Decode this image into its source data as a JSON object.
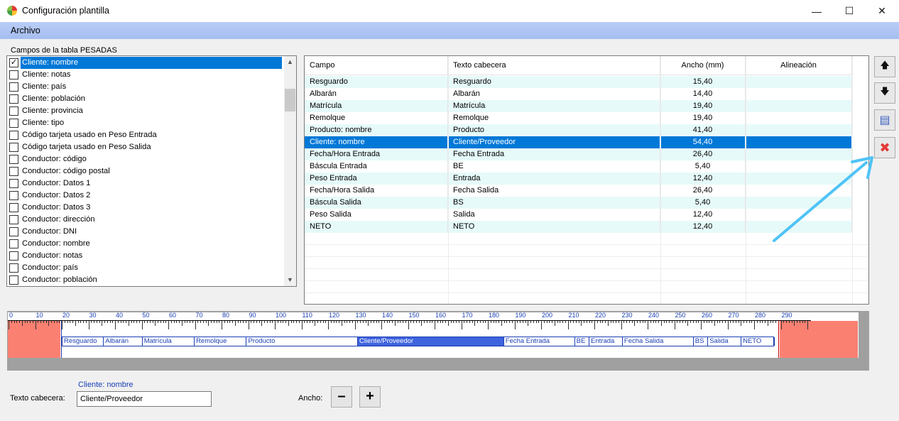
{
  "window": {
    "title": "Configuración plantilla",
    "controls": [
      "—",
      "☐",
      "✕"
    ]
  },
  "menu": {
    "items": [
      "Archivo"
    ]
  },
  "fields_panel": {
    "label": "Campos de la tabla PESADAS",
    "items": [
      {
        "label": "Cliente: nombre",
        "checked": true,
        "selected": true
      },
      {
        "label": "Cliente: notas",
        "checked": false
      },
      {
        "label": "Cliente: país",
        "checked": false
      },
      {
        "label": "Cliente: población",
        "checked": false
      },
      {
        "label": "Cliente: provincia",
        "checked": false
      },
      {
        "label": "Cliente: tipo",
        "checked": false
      },
      {
        "label": "Código tarjeta usado en Peso Entrada",
        "checked": false
      },
      {
        "label": "Código tarjeta usado en Peso Salida",
        "checked": false
      },
      {
        "label": "Conductor: código",
        "checked": false
      },
      {
        "label": "Conductor: código postal",
        "checked": false
      },
      {
        "label": "Conductor: Datos 1",
        "checked": false
      },
      {
        "label": "Conductor: Datos 2",
        "checked": false
      },
      {
        "label": "Conductor: Datos 3",
        "checked": false
      },
      {
        "label": "Conductor: dirección",
        "checked": false
      },
      {
        "label": "Conductor: DNI",
        "checked": false
      },
      {
        "label": "Conductor: nombre",
        "checked": false
      },
      {
        "label": "Conductor: notas",
        "checked": false
      },
      {
        "label": "Conductor: país",
        "checked": false
      },
      {
        "label": "Conductor: población",
        "checked": false
      }
    ]
  },
  "columns_grid": {
    "headers": [
      "Campo",
      "Texto cabecera",
      "Ancho (mm)",
      "Alineación"
    ],
    "rows": [
      {
        "campo": "Resguardo",
        "texto": "Resguardo",
        "ancho": "15,40",
        "alineacion": ""
      },
      {
        "campo": "Albarán",
        "texto": "Albarán",
        "ancho": "14,40",
        "alineacion": ""
      },
      {
        "campo": "Matrícula",
        "texto": "Matrícula",
        "ancho": "19,40",
        "alineacion": ""
      },
      {
        "campo": "Remolque",
        "texto": "Remolque",
        "ancho": "19,40",
        "alineacion": ""
      },
      {
        "campo": "Producto: nombre",
        "texto": "Producto",
        "ancho": "41,40",
        "alineacion": ""
      },
      {
        "campo": "Cliente: nombre",
        "texto": "Cliente/Proveedor",
        "ancho": "54,40",
        "alineacion": "",
        "selected": true
      },
      {
        "campo": "Fecha/Hora Entrada",
        "texto": "Fecha Entrada",
        "ancho": "26,40",
        "alineacion": ""
      },
      {
        "campo": "Báscula Entrada",
        "texto": "BE",
        "ancho": "5,40",
        "alineacion": ""
      },
      {
        "campo": "Peso Entrada",
        "texto": "Entrada",
        "ancho": "12,40",
        "alineacion": ""
      },
      {
        "campo": "Fecha/Hora Salida",
        "texto": "Fecha Salida",
        "ancho": "26,40",
        "alineacion": ""
      },
      {
        "campo": "Báscula Salida",
        "texto": "BS",
        "ancho": "5,40",
        "alineacion": ""
      },
      {
        "campo": "Peso Salida",
        "texto": "Salida",
        "ancho": "12,40",
        "alineacion": ""
      },
      {
        "campo": "NETO",
        "texto": "NETO",
        "ancho": "12,40",
        "alineacion": ""
      }
    ]
  },
  "side_buttons": [
    {
      "name": "move-up-button",
      "icon": "arrow-up-icon",
      "glyph": "🡅"
    },
    {
      "name": "move-down-button",
      "icon": "arrow-down-icon",
      "glyph": "🡇"
    },
    {
      "name": "properties-button",
      "icon": "document-settings-icon",
      "glyph": "▤"
    },
    {
      "name": "delete-button",
      "icon": "red-x-icon",
      "glyph": "✖"
    }
  ],
  "ruler": {
    "unit": "mm",
    "labels": [
      "0",
      "10",
      "20",
      "30",
      "40",
      "50",
      "60",
      "70",
      "80",
      "90",
      "100",
      "110",
      "120",
      "130",
      "140",
      "150",
      "160",
      "170",
      "180",
      "190",
      "200",
      "210",
      "220",
      "230",
      "240",
      "250",
      "260",
      "270",
      "280",
      "290"
    ],
    "columns": [
      "Resguardo",
      "Albarán",
      "Matrícula",
      "Remolque",
      "Producto",
      "Cliente/Proveedor",
      "Fecha Entrada",
      "BE",
      "Entrada",
      "Fecha Salida",
      "BS",
      "Salida",
      "NETO"
    ],
    "selected_column": "Cliente/Proveedor",
    "margin_color": "#fa8072",
    "band_color": "#1a3fb5"
  },
  "editor": {
    "selected_field": "Cliente: nombre",
    "texto_label": "Texto cabecera:",
    "texto_value": "Cliente/Proveedor",
    "ancho_label": "Ancho:",
    "minus": "–",
    "plus": "+"
  },
  "colors": {
    "selection": "#0078d7",
    "alt_row": "#e6fafa",
    "menubar": "#b9cdf6",
    "annotation_arrow": "#4fc3f7"
  }
}
